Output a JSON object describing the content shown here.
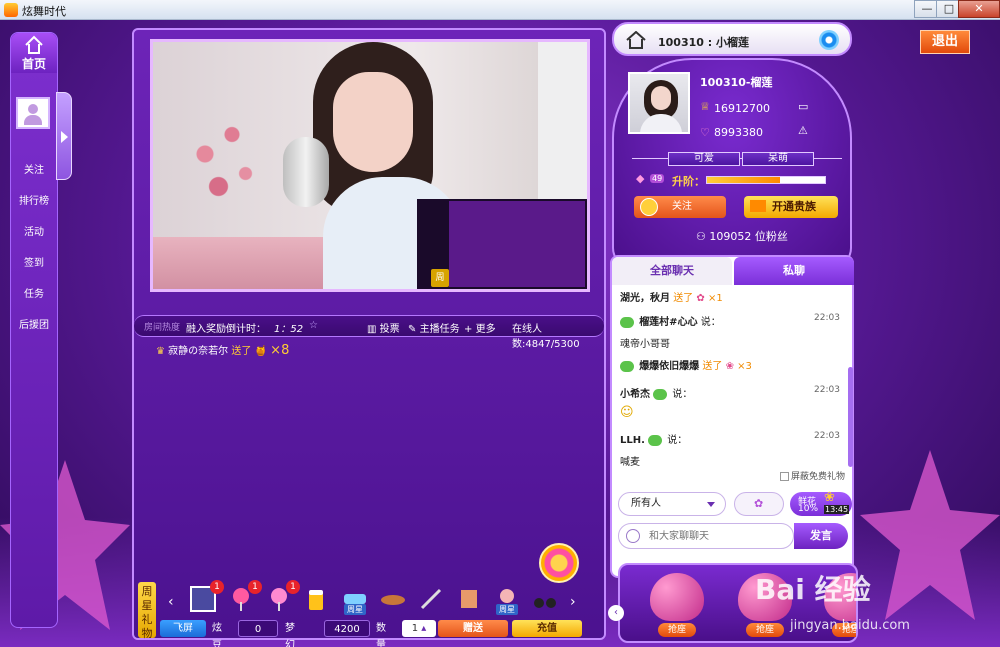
{
  "window": {
    "title": "炫舞时代",
    "minimize": "—",
    "maximize": "□",
    "close": "✕"
  },
  "leftnav": {
    "home": "首页",
    "items": [
      "关注",
      "排行榜",
      "活动",
      "签到",
      "任务",
      "后援团"
    ]
  },
  "infobar": {
    "room_hot": "房间热度",
    "countdown_label": "融入奖励倒计时：",
    "countdown_value": "1：52",
    "vote": "投票",
    "task": "主播任务",
    "more": "更多",
    "online": "在线人数:4847/5300"
  },
  "gift_line": {
    "user": "寂静の奈若尔",
    "sent": "送了",
    "count": "×8"
  },
  "pip": {
    "badge": "周"
  },
  "giftbar": {
    "weekstar": [
      "周",
      "星",
      "礼",
      "物"
    ],
    "prev": "‹",
    "next": "›",
    "gifts": [
      {
        "name": "gift-ring",
        "badge": "1",
        "tag": ""
      },
      {
        "name": "gift-lollipop",
        "badge": "1",
        "tag": ""
      },
      {
        "name": "gift-candy",
        "badge": "1",
        "tag": ""
      },
      {
        "name": "gift-beer",
        "badge": "",
        "tag": ""
      },
      {
        "name": "gift-car",
        "badge": "",
        "tag": "周星"
      },
      {
        "name": "gift-bread",
        "badge": "",
        "tag": ""
      },
      {
        "name": "gift-knife",
        "badge": "",
        "tag": ""
      },
      {
        "name": "gift-scroll",
        "badge": "",
        "tag": ""
      },
      {
        "name": "gift-doll",
        "badge": "",
        "tag": "周星"
      },
      {
        "name": "gift-motorbike",
        "badge": "",
        "tag": ""
      }
    ],
    "fullscreen": "飞屏",
    "beans_label": "炫豆",
    "beans_value": "0",
    "coins_label": "梦幻币",
    "coins_value": "4200",
    "qty_label": "数量",
    "qty_value": "1",
    "send": "赠送",
    "recharge": "充值"
  },
  "room": {
    "header": "100310 : 小榴莲",
    "exit": "退出"
  },
  "anchor": {
    "name": "100310-榴莲",
    "stat1": "16912700",
    "stat2": "8993380",
    "tags": [
      "可爱",
      "呆萌"
    ],
    "level_label": "升阶：",
    "level_badge": "49",
    "level_progress": 0.62,
    "follow": "关注",
    "noble": "开通贵族",
    "fans": "109052 位粉丝"
  },
  "chat": {
    "tab_all": "全部聊天",
    "tab_private": "私聊",
    "messages": [
      {
        "user": "湖光，秋月",
        "text": "送了",
        "extra": "×1",
        "time": ""
      },
      {
        "user": "榴莲村#心心",
        "text": "说：",
        "extra": "",
        "time": "22:03"
      },
      {
        "user": "",
        "text": "魂帝小哥哥",
        "extra": "",
        "time": ""
      },
      {
        "user": "爆爆依旧爆爆",
        "text": "送了",
        "extra": "×3",
        "time": ""
      },
      {
        "user": "小希杰",
        "text": "说：",
        "extra": "",
        "time": "22:03"
      },
      {
        "user": "LLH.",
        "text": "说：",
        "extra": "",
        "time": "22:03"
      },
      {
        "user": "",
        "text": "喊麦",
        "extra": "",
        "time": ""
      }
    ],
    "block_free": "屏蔽免费礼物",
    "target": "所有人",
    "flower_label": "鲜花",
    "flower_pct": "10%",
    "flower_time": "13:45",
    "input_placeholder": "和大家聊聊天",
    "send": "发言"
  },
  "seats": {
    "prev": "‹",
    "labels": [
      "抢座",
      "抢座",
      "抢座"
    ]
  },
  "watermark": {
    "main": "Bai 经验",
    "sub": "jingyan.baidu.com"
  },
  "colors": {
    "accent": "#7b2fd8",
    "orange": "#e4541a",
    "gold": "#f4a800"
  }
}
